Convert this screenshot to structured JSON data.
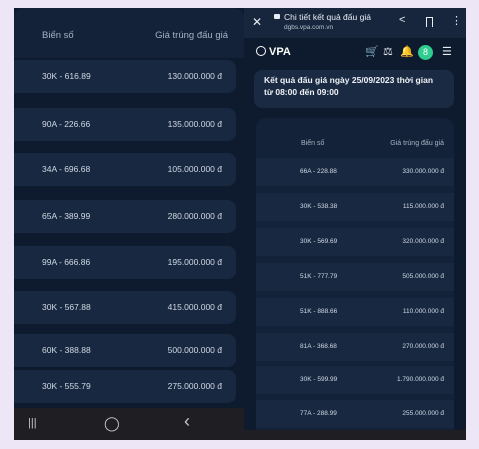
{
  "left": {
    "header": {
      "col_plate": "Biển số",
      "col_price": "Giá trúng đấu giá"
    },
    "rows": [
      {
        "plate": "30K - 616.89",
        "price": "130.000.000 đ"
      },
      {
        "plate": "90A - 226.66",
        "price": "135.000.000 đ"
      },
      {
        "plate": "34A - 696.68",
        "price": "105.000.000 đ"
      },
      {
        "plate": "65A - 389.99",
        "price": "280.000.000 đ"
      },
      {
        "plate": "99A - 666.86",
        "price": "195.000.000 đ"
      },
      {
        "plate": "30K - 567.88",
        "price": "415.000.000 đ"
      },
      {
        "plate": "60K - 388.88",
        "price": "500.000.000 đ"
      },
      {
        "plate": "30K - 555.79",
        "price": "275.000.000 đ"
      }
    ],
    "nav": {
      "recents": "|||",
      "home": "◯",
      "back": "‹"
    }
  },
  "right": {
    "browser": {
      "close": "✕",
      "title": "Chi tiết kết quả đấu giá",
      "url": "dgbs.vpa.com.vn",
      "share": "<",
      "menu": "⋮"
    },
    "app": {
      "logo": "VPA",
      "cart_icon": "🛒",
      "gavel_icon": "⚖",
      "bell_icon": "🔔",
      "avatar_letter": "8",
      "menu_icon": "☰"
    },
    "banner": "Kết quả đấu giá ngày 25/09/2023 thời gian từ 08:00 đến 09:00",
    "table": {
      "col_plate": "Biển số",
      "col_price": "Giá trúng đấu giá",
      "rows": [
        {
          "plate": "66A - 228.88",
          "price": "330.000.000 đ"
        },
        {
          "plate": "30K - 538.38",
          "price": "115.000.000 đ"
        },
        {
          "plate": "30K - 569.69",
          "price": "320.000.000 đ"
        },
        {
          "plate": "51K - 777.79",
          "price": "505.000.000 đ"
        },
        {
          "plate": "51K - 888.66",
          "price": "110.000.000 đ"
        },
        {
          "plate": "81A - 368.68",
          "price": "270.000.000 đ"
        },
        {
          "plate": "30K - 599.99",
          "price": "1.790.000.000 đ"
        },
        {
          "plate": "77A - 288.99",
          "price": "255.000.000 đ"
        }
      ]
    }
  },
  "colors": {
    "background": "#0e1a2e",
    "row": "#172840",
    "frame": "#ede6f7",
    "avatar": "#2ecc8f"
  }
}
